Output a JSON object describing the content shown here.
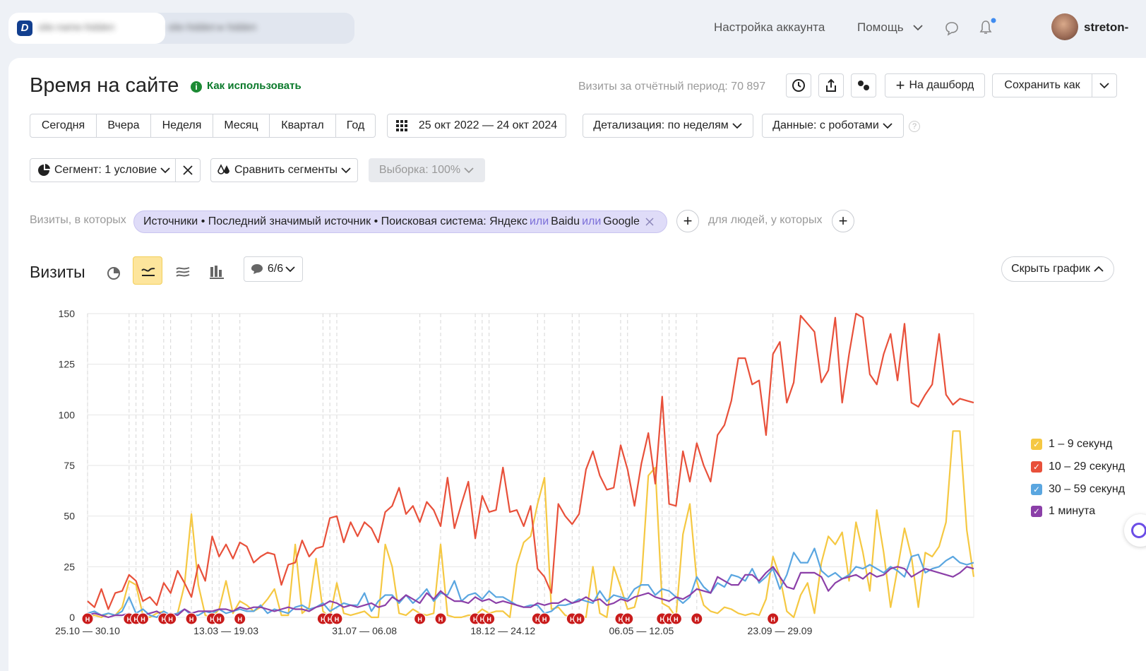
{
  "header": {
    "logo_letter": "D",
    "tab1_text": "site-name-hidden",
    "tab2_text": "site-hidden  ▸ hidden",
    "account_settings": "Настройка аккаунта",
    "help": "Помощь",
    "username": "streton-"
  },
  "page": {
    "title": "Время на сайте",
    "how_to_use": "Как использовать",
    "visits_total": "Визиты за отчётный период: 70 897",
    "to_dashboard": "На дашборд",
    "save_as": "Сохранить как"
  },
  "period_buttons": [
    "Сегодня",
    "Вчера",
    "Неделя",
    "Месяц",
    "Квартал",
    "Год"
  ],
  "date_range": "25 окт 2022 — 24 окт 2024",
  "detail": "Детализация: по неделям",
  "data_mode": "Данные: с роботами",
  "segment": "Сегмент: 1 условие",
  "compare_segments": "Сравнить сегменты",
  "sample": "Выборка: 100%",
  "filter": {
    "visits_where": "Визиты, в которых",
    "part1": "Источники • Последний значимый источник • Поисковая система: Яндекс",
    "or1": "или",
    "part2": "Baidu",
    "or2": "или",
    "part3": "Google",
    "people_where": "для людей, у которых"
  },
  "chart_header": {
    "title": "Визиты",
    "annotations_count": "6/6",
    "hide_chart": "Скрыть график"
  },
  "colors": {
    "s1": "#f5c842",
    "s2": "#e8503a",
    "s3": "#5aa6e0",
    "s4": "#8b3fa8",
    "accent_button": "#fde59c",
    "pill": "#dfdcf8"
  },
  "chart_data": {
    "type": "line",
    "ylim": [
      0,
      150
    ],
    "yticks": [
      0,
      25,
      50,
      75,
      100,
      125,
      150
    ],
    "xtick_labels": [
      "25.10 — 30.10",
      "13.03 — 19.03",
      "31.07 — 06.08",
      "18.12 — 24.12",
      "06.05 — 12.05",
      "23.09 — 29.09"
    ],
    "xtick_index": [
      0,
      20,
      40,
      60,
      80,
      100
    ],
    "series": [
      {
        "name": "1 – 9 секунд",
        "values": [
          0,
          1,
          0,
          2,
          1,
          5,
          18,
          16,
          1,
          0,
          2,
          3,
          0,
          2,
          16,
          51,
          16,
          1,
          0,
          4,
          18,
          2,
          8,
          6,
          3,
          5,
          9,
          14,
          1,
          1,
          36,
          2,
          5,
          29,
          3,
          0,
          17,
          2,
          1,
          2,
          3,
          0,
          0,
          36,
          25,
          2,
          1,
          4,
          2,
          1,
          2,
          36,
          1,
          0,
          0,
          1,
          1,
          4,
          2,
          3,
          3,
          0,
          26,
          37,
          40,
          56,
          69,
          4,
          5,
          1,
          0,
          1,
          0,
          25,
          2,
          0,
          25,
          15,
          4,
          5,
          18,
          70,
          74,
          7,
          5,
          0,
          41,
          56,
          18,
          6,
          3,
          2,
          5,
          4,
          2,
          1,
          2,
          1,
          9,
          30,
          20,
          3,
          0,
          11,
          17,
          2,
          27,
          40,
          36,
          42,
          18,
          47,
          32,
          13,
          53,
          32,
          5,
          24,
          44,
          30,
          5,
          32,
          30,
          35,
          47,
          92,
          92,
          43,
          20
        ]
      },
      {
        "name": "10 – 29 секунд",
        "values": [
          8,
          5,
          14,
          4,
          12,
          13,
          21,
          18,
          8,
          10,
          6,
          17,
          12,
          23,
          17,
          10,
          26,
          18,
          40,
          30,
          36,
          29,
          37,
          35,
          27,
          30,
          32,
          31,
          16,
          26,
          27,
          38,
          30,
          34,
          35,
          49,
          50,
          37,
          47,
          40,
          47,
          44,
          37,
          52,
          55,
          64,
          51,
          55,
          47,
          57,
          53,
          45,
          69,
          44,
          56,
          67,
          39,
          60,
          52,
          53,
          74,
          52,
          53,
          45,
          55,
          24,
          20,
          12,
          56,
          50,
          46,
          51,
          73,
          82,
          70,
          63,
          64,
          85,
          73,
          55,
          76,
          91,
          66,
          109,
          56,
          55,
          82,
          67,
          86,
          75,
          67,
          90,
          95,
          107,
          128,
          128,
          115,
          117,
          90,
          130,
          136,
          106,
          116,
          149,
          145,
          141,
          116,
          122,
          148,
          106,
          130,
          150,
          148,
          120,
          115,
          130,
          140,
          117,
          145,
          106,
          104,
          110,
          115,
          140,
          110,
          105,
          108,
          107,
          106
        ]
      },
      {
        "name": "30 – 59 секунд",
        "values": [
          2,
          3,
          1,
          2,
          1,
          3,
          10,
          2,
          4,
          1,
          0,
          3,
          1,
          2,
          4,
          1,
          1,
          3,
          2,
          4,
          2,
          3,
          4,
          3,
          3,
          6,
          2,
          4,
          3,
          2,
          5,
          6,
          4,
          5,
          7,
          3,
          5,
          7,
          6,
          6,
          12,
          3,
          8,
          11,
          11,
          7,
          11,
          7,
          10,
          14,
          8,
          12,
          11,
          18,
          8,
          11,
          12,
          9,
          13,
          10,
          10,
          8,
          6,
          5,
          6,
          6,
          2,
          3,
          6,
          6,
          7,
          9,
          8,
          7,
          13,
          8,
          11,
          10,
          9,
          14,
          16,
          16,
          11,
          14,
          13,
          10,
          7,
          10,
          20,
          15,
          12,
          17,
          15,
          21,
          20,
          18,
          24,
          17,
          20,
          24,
          14,
          21,
          32,
          27,
          27,
          34,
          23,
          20,
          22,
          19,
          21,
          25,
          24,
          26,
          24,
          22,
          25,
          23,
          20,
          30,
          31,
          22,
          24,
          25,
          28,
          30,
          27,
          26,
          27
        ]
      },
      {
        "name": "1 минута",
        "values": [
          1,
          2,
          1,
          0,
          1,
          1,
          2,
          0,
          1,
          2,
          3,
          1,
          2,
          1,
          4,
          2,
          3,
          3,
          3,
          4,
          4,
          3,
          5,
          4,
          5,
          5,
          4,
          3,
          4,
          5,
          4,
          4,
          3,
          5,
          6,
          8,
          7,
          5,
          6,
          5,
          6,
          7,
          5,
          6,
          10,
          8,
          11,
          9,
          7,
          12,
          9,
          13,
          10,
          8,
          8,
          7,
          10,
          8,
          9,
          7,
          8,
          7,
          6,
          5,
          5,
          7,
          6,
          7,
          7,
          9,
          7,
          8,
          10,
          8,
          9,
          6,
          7,
          9,
          8,
          10,
          11,
          12,
          10,
          9,
          8,
          10,
          9,
          11,
          14,
          13,
          12,
          20,
          18,
          16,
          16,
          21,
          21,
          18,
          22,
          25,
          20,
          15,
          14,
          22,
          22,
          22,
          20,
          13,
          17,
          19,
          20,
          21,
          19,
          22,
          20,
          21,
          24,
          25,
          24,
          20,
          22,
          24,
          23,
          22,
          21,
          20,
          22,
          25,
          24
        ]
      }
    ],
    "annotation_marks": [
      0,
      6,
      7,
      8,
      11,
      12,
      15,
      18,
      19,
      22,
      34,
      35,
      36,
      48,
      51,
      56,
      57,
      58,
      65,
      66,
      70,
      71,
      77,
      78,
      83,
      84,
      85,
      88,
      99
    ]
  }
}
